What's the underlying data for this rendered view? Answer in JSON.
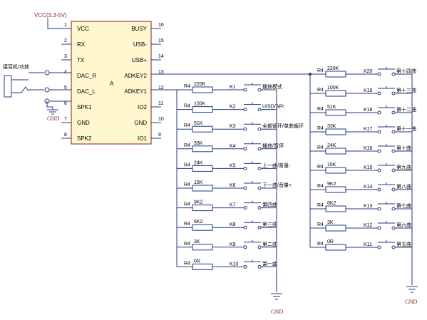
{
  "vcc_label": "VCC(3.3-5V)",
  "chip": {
    "ref": "A",
    "left_pins": [
      {
        "num": "1",
        "name": "VCC"
      },
      {
        "num": "2",
        "name": "RX"
      },
      {
        "num": "3",
        "name": "TX"
      },
      {
        "num": "4",
        "name": "DAC_R"
      },
      {
        "num": "5",
        "name": "DAC_L"
      },
      {
        "num": "6",
        "name": "SPK1"
      },
      {
        "num": "7",
        "name": "GND"
      },
      {
        "num": "8",
        "name": "SPK2"
      }
    ],
    "right_pins": [
      {
        "num": "16",
        "name": "BUSY"
      },
      {
        "num": "15",
        "name": "USB-"
      },
      {
        "num": "14",
        "name": "USB+"
      },
      {
        "num": "13",
        "name": "ADKEY2"
      },
      {
        "num": "12",
        "name": "ADKEY1"
      },
      {
        "num": "11",
        "name": "IO2"
      },
      {
        "num": "10",
        "name": "GND"
      },
      {
        "num": "9",
        "name": "IO1"
      }
    ]
  },
  "jack_label": "接耳机/功放",
  "gnd_label": "GND",
  "left_ladder": [
    {
      "r": "R4",
      "value": "220K",
      "key": "K1",
      "func": "播放模式"
    },
    {
      "r": "R4",
      "value": "100K",
      "key": "K2",
      "func": "U/SD/SPI"
    },
    {
      "r": "R4",
      "value": "51K",
      "key": "K3",
      "func": "全部循环/单曲循环"
    },
    {
      "r": "R4",
      "value": "33K",
      "key": "K4",
      "func": "播放/暂停"
    },
    {
      "r": "R4",
      "value": "24K",
      "key": "K5",
      "func": "上一曲/音量-"
    },
    {
      "r": "R4",
      "value": "15K",
      "key": "K6",
      "func": "下一曲/音量+"
    },
    {
      "r": "R4",
      "value": "9K2",
      "key": "K7",
      "func": "第四曲"
    },
    {
      "r": "R4",
      "value": "6K2",
      "key": "K8",
      "func": "第三曲"
    },
    {
      "r": "R4",
      "value": "3K",
      "key": "K9",
      "func": "第二曲"
    },
    {
      "r": "R4",
      "value": "0R",
      "key": "K10",
      "func": "第一曲"
    }
  ],
  "right_ladder": [
    {
      "r": "R4",
      "value": "220K",
      "key": "K20",
      "func": "第十四曲"
    },
    {
      "r": "R4",
      "value": "100K",
      "key": "K19",
      "func": "第十三曲"
    },
    {
      "r": "R4",
      "value": "51K",
      "key": "K18",
      "func": "第十二曲"
    },
    {
      "r": "R4",
      "value": "33K",
      "key": "K17",
      "func": "第十一曲"
    },
    {
      "r": "R4",
      "value": "24K",
      "key": "K16",
      "func": "第十曲"
    },
    {
      "r": "R4",
      "value": "15K",
      "key": "K15",
      "func": "第九曲"
    },
    {
      "r": "R4",
      "value": "9K2",
      "key": "K14",
      "func": "第八曲"
    },
    {
      "r": "R4",
      "value": "6K2",
      "key": "K13",
      "func": "第七曲"
    },
    {
      "r": "R4",
      "value": "3K",
      "key": "K12",
      "func": "第六曲"
    },
    {
      "r": "R4",
      "value": "0R",
      "key": "K11",
      "func": "第五曲"
    }
  ]
}
